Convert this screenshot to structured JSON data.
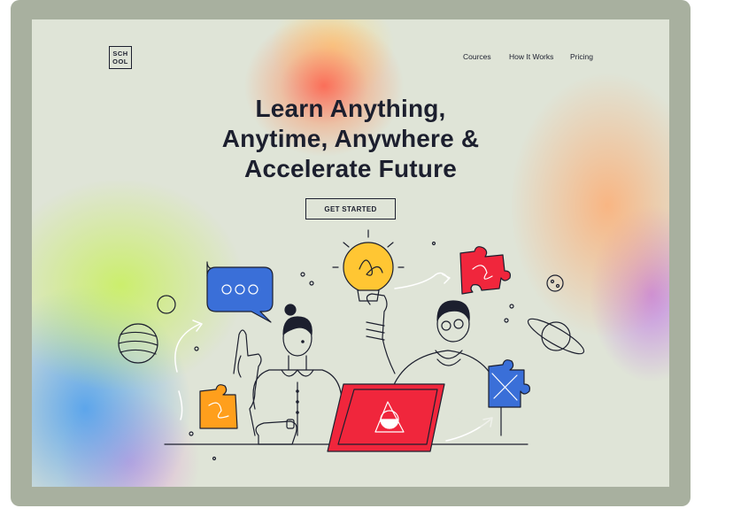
{
  "logo": {
    "line1": "SCH",
    "line2": "OOL"
  },
  "nav": {
    "items": [
      {
        "label": "Cources"
      },
      {
        "label": "How It Works"
      },
      {
        "label": "Pricing"
      }
    ]
  },
  "hero": {
    "headline_line1": "Learn Anything,",
    "headline_line2": "Anytime, Anywhere &",
    "headline_line3": "Accelerate Future",
    "cta_label": "GET STARTED"
  },
  "illustration": {
    "icons": [
      "chat-bubble-icon",
      "lightbulb-icon",
      "puzzle-piece-icon",
      "planet-icon",
      "laptop-icon"
    ]
  },
  "colors": {
    "ink": "#1c1f2e",
    "frame": "#a8b09f",
    "background": "#dfe4d7",
    "red": "#f0263c",
    "blue": "#3a6fd8",
    "orange": "#ff9f1c",
    "yellow": "#ffc633"
  }
}
